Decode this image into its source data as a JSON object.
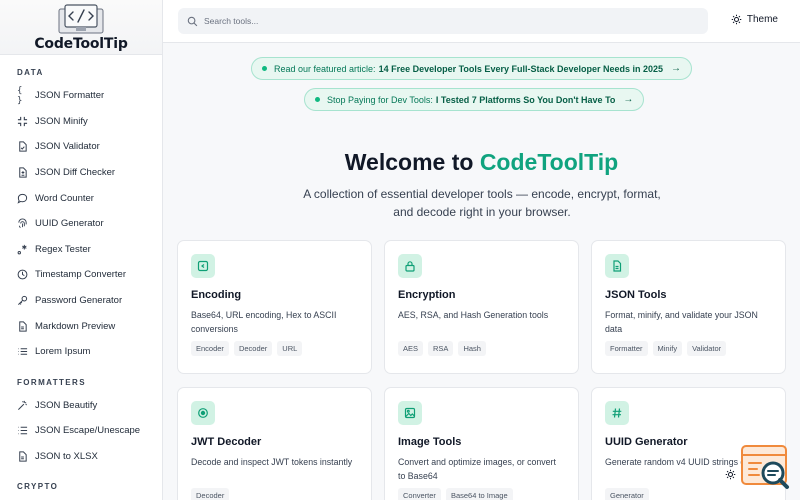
{
  "brand": {
    "name": "CodeToolTip"
  },
  "sidebar": {
    "sections": [
      {
        "title": "DATA"
      },
      {
        "title": "FORMATTERS"
      },
      {
        "title": "CRYPTO"
      }
    ],
    "data_items": [
      {
        "label": "JSON Formatter",
        "icon": "braces-icon"
      },
      {
        "label": "JSON Minify",
        "icon": "minimize-icon"
      },
      {
        "label": "JSON Validator",
        "icon": "file-check-icon"
      },
      {
        "label": "JSON Diff Checker",
        "icon": "file-diff-icon"
      },
      {
        "label": "Word Counter",
        "icon": "chat-icon"
      },
      {
        "label": "UUID Generator",
        "icon": "fingerprint-icon"
      },
      {
        "label": "Regex Tester",
        "icon": "regex-icon"
      },
      {
        "label": "Timestamp Converter",
        "icon": "clock-icon"
      },
      {
        "label": "Password Generator",
        "icon": "key-icon"
      },
      {
        "label": "Markdown Preview",
        "icon": "file-text-icon"
      },
      {
        "label": "Lorem Ipsum",
        "icon": "list-icon"
      }
    ],
    "formatter_items": [
      {
        "label": "JSON Beautify",
        "icon": "wand-icon"
      },
      {
        "label": "JSON Escape/Unescape",
        "icon": "escape-icon"
      },
      {
        "label": "JSON to XLSX",
        "icon": "file-xlsx-icon"
      }
    ]
  },
  "search": {
    "placeholder": "Search tools..."
  },
  "theme": {
    "label": "Theme"
  },
  "banners": [
    {
      "prefix": "Read our featured article:",
      "highlight": "14 Free Developer Tools Every Full-Stack Developer Needs in 2025"
    },
    {
      "prefix": "Stop Paying for Dev Tools:",
      "highlight": "I Tested 7 Platforms So You Don't Have To"
    }
  ],
  "hero": {
    "title_prefix": "Welcome to",
    "title_accent": "CodeToolTip",
    "subtitle": "A collection of essential developer tools — encode, encrypt, format, and decode right in your browser."
  },
  "cards": [
    {
      "title": "Encoding",
      "desc": "Base64, URL encoding, Hex to ASCII conversions",
      "tags": [
        "Encoder",
        "Decoder",
        "URL"
      ],
      "icon": "code-square-icon"
    },
    {
      "title": "Encryption",
      "desc": "AES, RSA, and Hash Generation tools",
      "tags": [
        "AES",
        "RSA",
        "Hash"
      ],
      "icon": "lock-icon"
    },
    {
      "title": "JSON Tools",
      "desc": "Format, minify, and validate your JSON data",
      "tags": [
        "Formatter",
        "Minify",
        "Validator"
      ],
      "icon": "file-icon"
    },
    {
      "title": "JWT Decoder",
      "desc": "Decode and inspect JWT tokens instantly",
      "tags": [
        "Decoder"
      ],
      "icon": "target-icon"
    },
    {
      "title": "Image Tools",
      "desc": "Convert and optimize images, or convert to Base64",
      "tags": [
        "Converter",
        "Base64 to Image"
      ],
      "icon": "image-icon"
    },
    {
      "title": "UUID Generator",
      "desc": "Generate random v4 UUID strings quickly",
      "tags": [
        "Generator"
      ],
      "icon": "hash-icon"
    }
  ],
  "colors": {
    "accent": "#10a37f",
    "accent_bg": "#d1f2e4",
    "pill_bg": "#e8f7f1",
    "pill_border": "#a7e3cf"
  }
}
